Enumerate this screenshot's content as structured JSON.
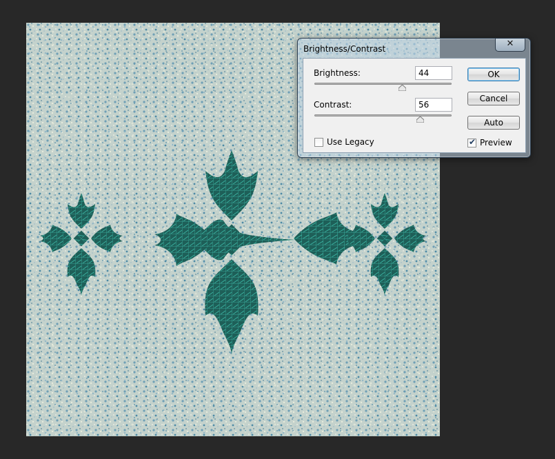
{
  "dialog": {
    "title": "Brightness/Contrast",
    "close_label": "✕",
    "brightness": {
      "label": "Brightness:",
      "value": "44",
      "slider_fraction": 0.64
    },
    "contrast": {
      "label": "Contrast:",
      "value": "56",
      "slider_fraction": 0.77
    },
    "use_legacy": {
      "label": "Use Legacy",
      "checked": false
    },
    "preview": {
      "label": "Preview",
      "checked": true,
      "check_glyph": "✔"
    },
    "buttons": {
      "ok": "OK",
      "cancel": "Cancel",
      "auto": "Auto"
    }
  },
  "canvas": {
    "background_color": "#c9d6cf",
    "motif_color": "#1e5f58",
    "grout_color": "#3cb8a6"
  }
}
